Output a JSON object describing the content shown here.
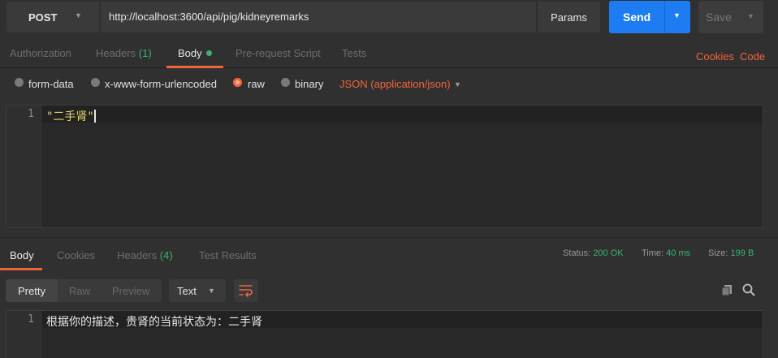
{
  "request": {
    "method": "POST",
    "url": "http://localhost:3600/api/pig/kidneyremarks",
    "params_label": "Params",
    "send_label": "Send",
    "save_label": "Save"
  },
  "request_tabs": {
    "authorization": "Authorization",
    "headers": "Headers",
    "headers_count": "(1)",
    "body": "Body",
    "prerequest": "Pre-request Script",
    "tests": "Tests",
    "cookies": "Cookies",
    "code": "Code"
  },
  "body_options": {
    "form_data": "form-data",
    "urlencoded": "x-www-form-urlencoded",
    "raw": "raw",
    "binary": "binary",
    "selected": "raw",
    "content_type": "JSON (application/json)"
  },
  "request_body": {
    "line_number": "1",
    "code": "\"二手肾\""
  },
  "response_tabs": {
    "body": "Body",
    "cookies": "Cookies",
    "headers": "Headers",
    "headers_count": "(4)",
    "test_results": "Test Results"
  },
  "response_status": {
    "status_label": "Status:",
    "status_value": "200 OK",
    "time_label": "Time:",
    "time_value": "40 ms",
    "size_label": "Size:",
    "size_value": "199 B"
  },
  "response_format": {
    "pretty": "Pretty",
    "raw": "Raw",
    "preview": "Preview",
    "text": "Text"
  },
  "response_body": {
    "line_number": "1",
    "text": "根据你的描述，贵肾的当前状态为：二手肾"
  },
  "colors": {
    "accent": "#f0653b",
    "send": "#1e7cf2",
    "success": "#3cb371"
  }
}
